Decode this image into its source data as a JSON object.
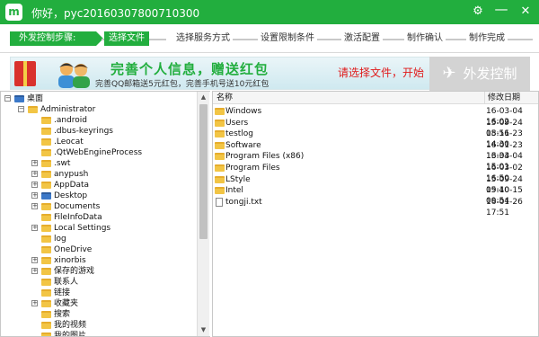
{
  "app": {
    "logo_text": "m",
    "title": "你好，pyc20160307800710300"
  },
  "titlebar": {
    "gear": "⚙",
    "minimize": "—",
    "close": "✕"
  },
  "steps": {
    "label": "外发控制步骤:",
    "items": [
      "选择文件",
      "选择服务方式",
      "设置限制条件",
      "激活配置",
      "制作确认",
      "制作完成"
    ],
    "active_index": 0
  },
  "banner": {
    "headline": "完善个人信息，赠送红包",
    "subtext": "完善QQ邮箱送5元红包，完善手机号送10元红包",
    "hint": "请选择文件，开始",
    "send_button": "外发控制"
  },
  "tree": {
    "nodes": [
      {
        "label": "桌面",
        "level": 0,
        "expander": "−",
        "icon": "desktop"
      },
      {
        "label": "Administrator",
        "level": 1,
        "expander": "−",
        "icon": "user"
      },
      {
        "label": ".android",
        "level": 2,
        "expander": "",
        "icon": "folder"
      },
      {
        "label": ".dbus-keyrings",
        "level": 2,
        "expander": "",
        "icon": "folder"
      },
      {
        "label": ".Leocat",
        "level": 2,
        "expander": "",
        "icon": "folder"
      },
      {
        "label": ".QtWebEngineProcess",
        "level": 2,
        "expander": "",
        "icon": "folder"
      },
      {
        "label": ".swt",
        "level": 2,
        "expander": "+",
        "icon": "folder"
      },
      {
        "label": "anypush",
        "level": 2,
        "expander": "+",
        "icon": "folder"
      },
      {
        "label": "AppData",
        "level": 2,
        "expander": "+",
        "icon": "folder"
      },
      {
        "label": "Desktop",
        "level": 2,
        "expander": "+",
        "icon": "desktop"
      },
      {
        "label": "Documents",
        "level": 2,
        "expander": "+",
        "icon": "folder"
      },
      {
        "label": "FileInfoData",
        "level": 2,
        "expander": "",
        "icon": "folder"
      },
      {
        "label": "Local Settings",
        "level": 2,
        "expander": "+",
        "icon": "folder"
      },
      {
        "label": "log",
        "level": 2,
        "expander": "",
        "icon": "folder"
      },
      {
        "label": "OneDrive",
        "level": 2,
        "expander": "",
        "icon": "folder"
      },
      {
        "label": "xinorbis",
        "level": 2,
        "expander": "+",
        "icon": "folder"
      },
      {
        "label": "保存的游戏",
        "level": 2,
        "expander": "+",
        "icon": "folder"
      },
      {
        "label": "联系人",
        "level": 2,
        "expander": "",
        "icon": "folder"
      },
      {
        "label": "链接",
        "level": 2,
        "expander": "",
        "icon": "folder"
      },
      {
        "label": "收藏夹",
        "level": 2,
        "expander": "+",
        "icon": "folder"
      },
      {
        "label": "搜索",
        "level": 2,
        "expander": "",
        "icon": "folder"
      },
      {
        "label": "我的视频",
        "level": 2,
        "expander": "",
        "icon": "folder"
      },
      {
        "label": "我的图片",
        "level": 2,
        "expander": "",
        "icon": "folder"
      }
    ]
  },
  "list": {
    "columns": [
      "名称",
      "修改日期"
    ],
    "rows": [
      {
        "name": "Windows",
        "date": "16-03-04 16:02",
        "type": "folder"
      },
      {
        "name": "Users",
        "date": "15-09-24 08:56",
        "type": "folder"
      },
      {
        "name": "testlog",
        "date": "15-11-23 14:30",
        "type": "folder"
      },
      {
        "name": "Software",
        "date": "16-01-23 13:34",
        "type": "folder"
      },
      {
        "name": "Program Files (x86)",
        "date": "16-03-04 15:01",
        "type": "folder"
      },
      {
        "name": "Program Files",
        "date": "16-03-02 16:50",
        "type": "folder"
      },
      {
        "name": "LStyle",
        "date": "15-09-24 09:40",
        "type": "folder"
      },
      {
        "name": "Intel",
        "date": "15-10-15 09:54",
        "type": "folder"
      },
      {
        "name": "tongji.txt",
        "date": "16-01-26 17:51",
        "type": "file"
      }
    ]
  },
  "colors": {
    "accent": "#22ae3e",
    "hint": "#e01a1a"
  }
}
